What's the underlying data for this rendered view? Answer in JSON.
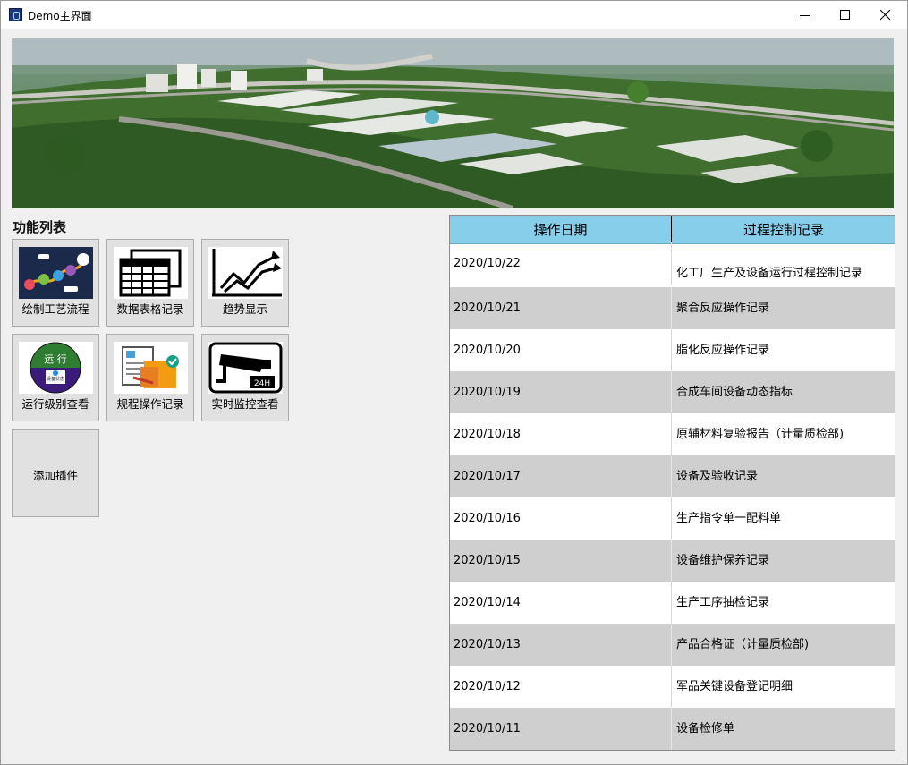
{
  "window": {
    "title": "Demo主界面"
  },
  "functions": {
    "title": "功能列表",
    "tiles": [
      {
        "label": "绘制工艺流程",
        "icon": "process-flow-icon"
      },
      {
        "label": "数据表格记录",
        "icon": "data-table-icon"
      },
      {
        "label": "趋势显示",
        "icon": "trend-chart-icon"
      },
      {
        "label": "运行级别查看",
        "icon": "run-level-badge-icon",
        "badge_text": "运 行",
        "badge_subtext": "设备状态"
      },
      {
        "label": "规程操作记录",
        "icon": "procedure-record-icon"
      },
      {
        "label": "实时监控查看",
        "icon": "cctv-camera-icon",
        "badge_text": "24H"
      }
    ],
    "add_plugin": "添加插件"
  },
  "records": {
    "headers": [
      "操作日期",
      "过程控制记录"
    ],
    "rows": [
      [
        "2020/10/22",
        "化工厂生产及设备运行过程控制记录"
      ],
      [
        "2020/10/21",
        "聚合反应操作记录"
      ],
      [
        "2020/10/20",
        "脂化反应操作记录"
      ],
      [
        "2020/10/19",
        "合成车间设备动态指标"
      ],
      [
        "2020/10/18",
        "原辅材料复验报告（计量质检部)"
      ],
      [
        "2020/10/17",
        "设备及验收记录"
      ],
      [
        "2020/10/16",
        "生产指令单一配料单"
      ],
      [
        "2020/10/15",
        "设备维护保养记录"
      ],
      [
        "2020/10/14",
        "生产工序抽检记录"
      ],
      [
        "2020/10/13",
        "产品合格证（计量质检部)"
      ],
      [
        "2020/10/12",
        "军品关键设备登记明细"
      ],
      [
        "2020/10/11",
        "设备检修单"
      ]
    ]
  },
  "colors": {
    "header_bg": "#87ceeb",
    "row_alt": "#cfcfcf",
    "tile_bg": "#e1e1e1"
  }
}
